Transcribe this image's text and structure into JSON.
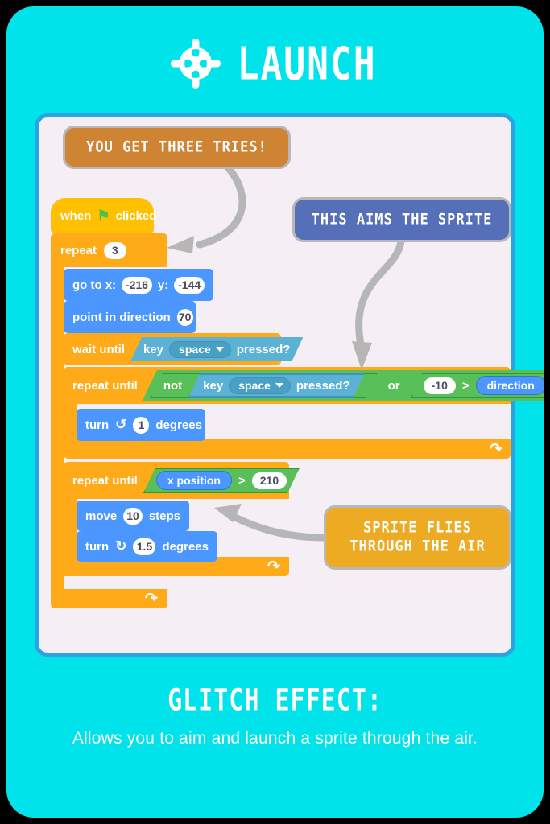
{
  "card": {
    "background_color": "#00e3ea",
    "panel_fill": "#f5eef5",
    "panel_border": "#2aa3e2"
  },
  "header": {
    "title": "LAUNCH",
    "icon": "target-crosshair-icon"
  },
  "footer": {
    "effect_label": "GLITCH EFFECT:",
    "effect_description": "Allows you to aim and launch a sprite through the air."
  },
  "callouts": [
    {
      "id": "tries",
      "text": "YOU GET THREE TRIES!",
      "color": "#cf8434"
    },
    {
      "id": "aims",
      "text": "THIS AIMS THE SPRITE",
      "color": "#5570b8"
    },
    {
      "id": "flies",
      "line1": "SPRITE FLIES",
      "line2": "THROUGH THE AIR",
      "color": "#edab24"
    }
  ],
  "script": {
    "hat": {
      "when": "when",
      "flag_icon": "green-flag-icon",
      "clicked": "clicked"
    },
    "repeat": {
      "label": "repeat",
      "times": "3"
    },
    "goto": {
      "label": "go to x:",
      "x": "-216",
      "y_label": "y:",
      "y": "-144"
    },
    "point": {
      "label": "point in direction",
      "direction": "70"
    },
    "wait_until": {
      "label": "wait until",
      "key_label": "key",
      "key_value": "space",
      "pressed_label": "pressed?"
    },
    "repeat_until_aim": {
      "label": "repeat until",
      "not_label": "not",
      "key_label": "key",
      "key_value": "space",
      "pressed_label": "pressed?",
      "or_label": "or",
      "left_operand": "-10",
      "operator": ">",
      "right_operand": "direction"
    },
    "turn_ccw": {
      "label": "turn",
      "icon": "turn-counterclockwise-icon",
      "degrees": "1",
      "unit": "degrees"
    },
    "repeat_until_fly": {
      "label": "repeat until",
      "left_operand": "x position",
      "operator": ">",
      "right_operand": "210"
    },
    "move": {
      "label": "move",
      "steps": "10",
      "unit": "steps"
    },
    "turn_cw": {
      "label": "turn",
      "icon": "turn-clockwise-icon",
      "degrees": "1.5",
      "unit": "degrees"
    }
  }
}
